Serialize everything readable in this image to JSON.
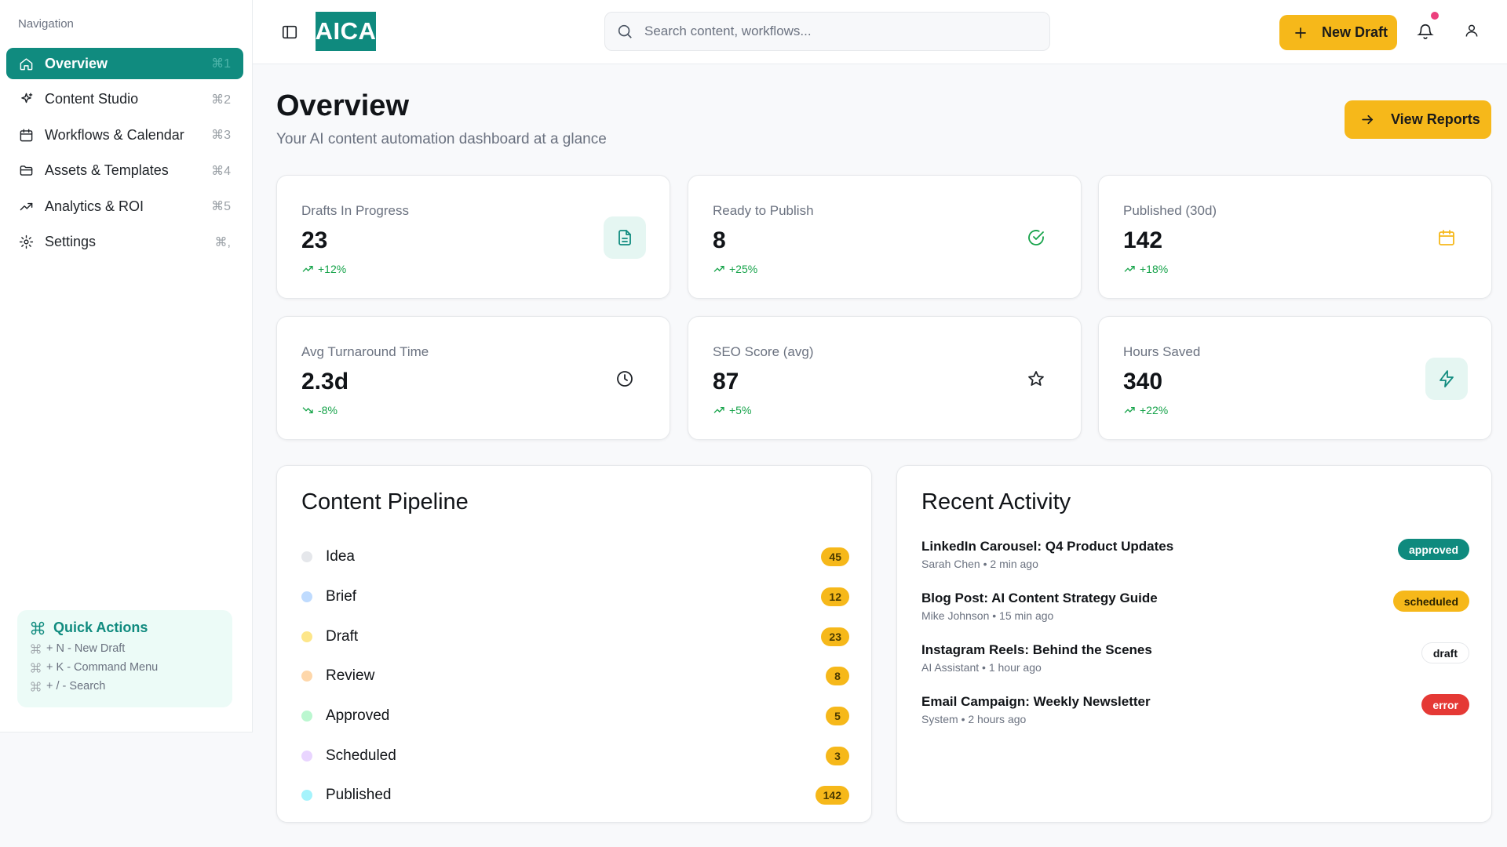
{
  "sidebar": {
    "heading": "Navigation",
    "items": [
      {
        "label": "Overview",
        "shortcut": "⌘1",
        "icon": "home-icon"
      },
      {
        "label": "Content Studio",
        "shortcut": "⌘2",
        "icon": "sparkles-icon"
      },
      {
        "label": "Workflows & Calendar",
        "shortcut": "⌘3",
        "icon": "calendar-icon"
      },
      {
        "label": "Assets & Templates",
        "shortcut": "⌘4",
        "icon": "folder-icon"
      },
      {
        "label": "Analytics & ROI",
        "shortcut": "⌘5",
        "icon": "trending-up-icon"
      },
      {
        "label": "Settings",
        "shortcut": "⌘,",
        "icon": "gear-icon"
      }
    ],
    "active_index": 0,
    "quick_actions": {
      "title": "Quick Actions",
      "lines": [
        "+ N - New Draft",
        "+ K - Command Menu",
        "+ / - Search"
      ]
    }
  },
  "header": {
    "logo": "AICA",
    "search_placeholder": "Search content, workflows...",
    "new_draft_label": "New Draft",
    "has_notification": true
  },
  "main": {
    "title": "Overview",
    "subtitle": "Your AI content automation dashboard at a glance",
    "view_reports_label": "View Reports",
    "stats": [
      {
        "label": "Drafts In Progress",
        "value": "23",
        "trend": "+12%",
        "direction": "up",
        "icon": "document-icon",
        "icon_color": "#108b7f",
        "icon_bg": "#e5f6f2"
      },
      {
        "label": "Ready to Publish",
        "value": "8",
        "trend": "+25%",
        "direction": "up",
        "icon": "check-circle-icon",
        "icon_color": "#16a34a",
        "icon_bg": "transparent"
      },
      {
        "label": "Published (30d)",
        "value": "142",
        "trend": "+18%",
        "direction": "up",
        "icon": "calendar-icon",
        "icon_color": "#f6b81a",
        "icon_bg": "transparent"
      },
      {
        "label": "Avg Turnaround Time",
        "value": "2.3d",
        "trend": "-8%",
        "direction": "down",
        "icon": "clock-icon",
        "icon_color": "#1f2328",
        "icon_bg": "transparent"
      },
      {
        "label": "SEO Score (avg)",
        "value": "87",
        "trend": "+5%",
        "direction": "up",
        "icon": "star-icon",
        "icon_color": "#1f2328",
        "icon_bg": "transparent"
      },
      {
        "label": "Hours Saved",
        "value": "340",
        "trend": "+22%",
        "direction": "up",
        "icon": "lightning-icon",
        "icon_color": "#108b7f",
        "icon_bg": "#e5f6f2"
      }
    ],
    "pipeline": {
      "title": "Content Pipeline",
      "stages": [
        {
          "label": "Idea",
          "count": "45",
          "color": "#e5e7eb"
        },
        {
          "label": "Brief",
          "count": "12",
          "color": "#bfdbfe"
        },
        {
          "label": "Draft",
          "count": "23",
          "color": "#fde68a"
        },
        {
          "label": "Review",
          "count": "8",
          "color": "#fed7aa"
        },
        {
          "label": "Approved",
          "count": "5",
          "color": "#bbf7d0"
        },
        {
          "label": "Scheduled",
          "count": "3",
          "color": "#e9d5ff"
        },
        {
          "label": "Published",
          "count": "142",
          "color": "#a5f3fc"
        }
      ]
    },
    "activity": {
      "title": "Recent Activity",
      "items": [
        {
          "title": "LinkedIn Carousel: Q4 Product Updates",
          "meta": "Sarah Chen • 2 min ago",
          "status": "approved",
          "bg": "#0f8a7e",
          "fg": "#ffffff",
          "border": "none"
        },
        {
          "title": "Blog Post: AI Content Strategy Guide",
          "meta": "Mike Johnson • 15 min ago",
          "status": "scheduled",
          "bg": "#f6b81a",
          "fg": "#2a2200",
          "border": "none"
        },
        {
          "title": "Instagram Reels: Behind the Scenes",
          "meta": "AI Assistant • 1 hour ago",
          "status": "draft",
          "bg": "#ffffff",
          "fg": "#111418",
          "border": "1px solid #e6e8eb"
        },
        {
          "title": "Email Campaign: Weekly Newsletter",
          "meta": "System • 2 hours ago",
          "status": "error",
          "bg": "#e53935",
          "fg": "#ffffff",
          "border": "none"
        }
      ]
    }
  }
}
